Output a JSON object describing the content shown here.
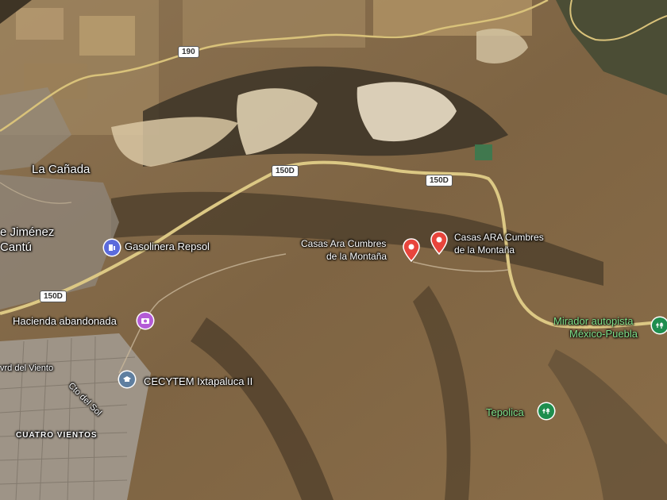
{
  "map": {
    "view": "satellite",
    "places": {
      "la_canada": "La Cañada",
      "jimenez_line1": "e Jiménez",
      "jimenez_line2": "Cantú",
      "cuatro_vientos": "CUATRO VIENTOS",
      "street_viento": "vrd del Viento",
      "street_sol": "Cto del Sol"
    },
    "roads": {
      "r190": "190",
      "r150d_a": "150D",
      "r150d_b": "150D",
      "r150d_c": "150D"
    },
    "pois": {
      "gasolinera": "Gasolinera Repsol",
      "hacienda": "Hacienda abandonada",
      "cecytem": "CECYTEM Ixtapaluca II",
      "casas_ara_line1": "Casas Ara Cumbres",
      "casas_ara_line2": "de la Montaña",
      "casas_ARA_line1": "Casas ARA Cumbres",
      "casas_ARA_line2": "de la Montaña",
      "mirador_line1": "Mirador autopista",
      "mirador_line2": "México-Puebla",
      "tepolica": "Tepolica"
    },
    "icons": {
      "gas": "gas-station-icon",
      "camera": "camera-icon",
      "school": "school-icon",
      "pin": "map-pin-icon",
      "park": "park-icon"
    },
    "colors": {
      "pin_red": "#e8453c",
      "gas_blue": "#5b6bdc",
      "camera_purple": "#b45bd6",
      "school_gray": "#5f7fa0",
      "park_green": "#1e8e4e",
      "road_yellow": "#d9c27a"
    }
  }
}
